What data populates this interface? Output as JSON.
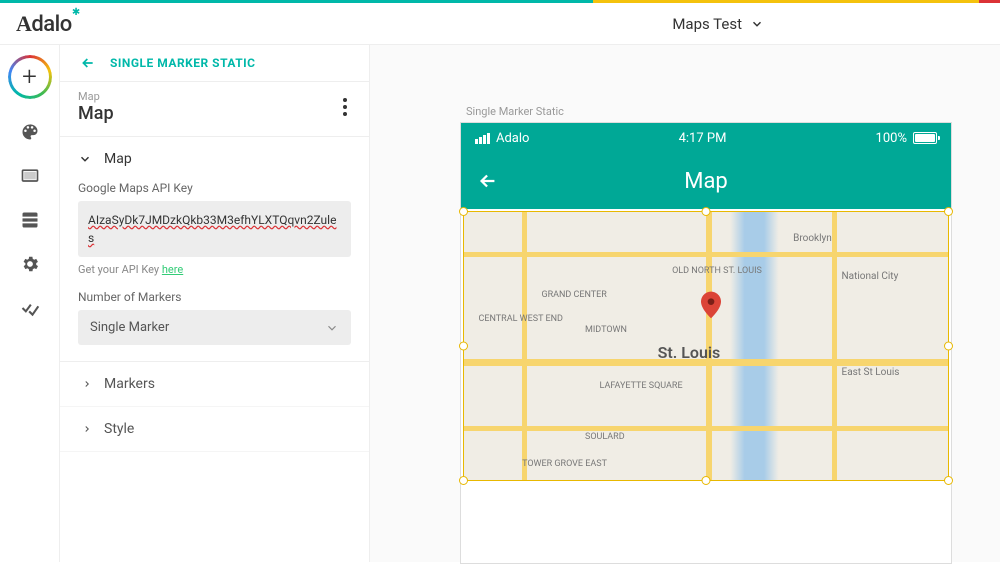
{
  "header": {
    "logo_text": "Adalo",
    "project_name": "Maps Test"
  },
  "panel": {
    "breadcrumb": "SINGLE MARKER STATIC",
    "component_type": "Map",
    "component_name": "Map",
    "sections": {
      "map": {
        "title": "Map",
        "api_key_label": "Google Maps API Key",
        "api_key_value": "AIzaSyDk7JMDzkQkb33M3efhYLXTQqvn2Zules",
        "help_text": "Get your API Key ",
        "help_link": "here",
        "num_markers_label": "Number of Markers",
        "num_markers_value": "Single Marker"
      },
      "markers": {
        "title": "Markers"
      },
      "style": {
        "title": "Style"
      }
    }
  },
  "canvas": {
    "screen_label": "Single Marker Static",
    "phone": {
      "carrier": "Adalo",
      "time": "4:17 PM",
      "battery_pct": "100%",
      "appbar_title": "Map",
      "map": {
        "city": "St. Louis",
        "neighborhoods": [
          "Brooklyn",
          "National City",
          "East St Louis",
          "OLD NORTH ST. LOUIS",
          "GRAND CENTER",
          "CENTRAL WEST END",
          "MIDTOWN",
          "LAFAYETTE SQUARE",
          "SOULARD",
          "TOWER GROVE EAST"
        ]
      }
    }
  }
}
